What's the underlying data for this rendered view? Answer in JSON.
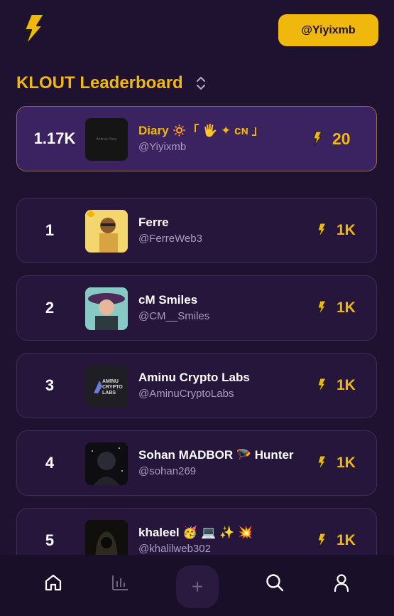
{
  "header": {
    "handle_button": "@Yiyixmb"
  },
  "leaderboard": {
    "title": "KLOUT Leaderboard"
  },
  "me": {
    "score": "1.17K",
    "avatar_text": "Airdrop Diary",
    "name": "Diary 🔅「 🖐 ✦ ᴄɴ 」",
    "handle": "@Yiyixmb",
    "points": "20"
  },
  "rows": [
    {
      "rank": "1",
      "name": "Ferre",
      "handle": "@FerreWeb3",
      "points": "1K"
    },
    {
      "rank": "2",
      "name": "cM Smiles",
      "handle": "@CM__Smiles",
      "points": "1K"
    },
    {
      "rank": "3",
      "name": "Aminu Crypto Labs",
      "handle": "@AminuCryptoLabs",
      "points": "1K",
      "avatar_text": "AMINU CRYPTO LABS"
    },
    {
      "rank": "4",
      "name": "Sohan MADBOR 🪂 Hunter",
      "handle": "@sohan269",
      "points": "1K"
    },
    {
      "rank": "5",
      "name": "khaleel 🥳 💻 ✨ 💥",
      "handle": "@khalilweb302",
      "points": "1K"
    }
  ],
  "nav": {
    "plus": "+"
  },
  "colors": {
    "accent": "#f0b70d",
    "background": "#1f1230",
    "card": "#26163b",
    "me_card": "#3b2260"
  }
}
